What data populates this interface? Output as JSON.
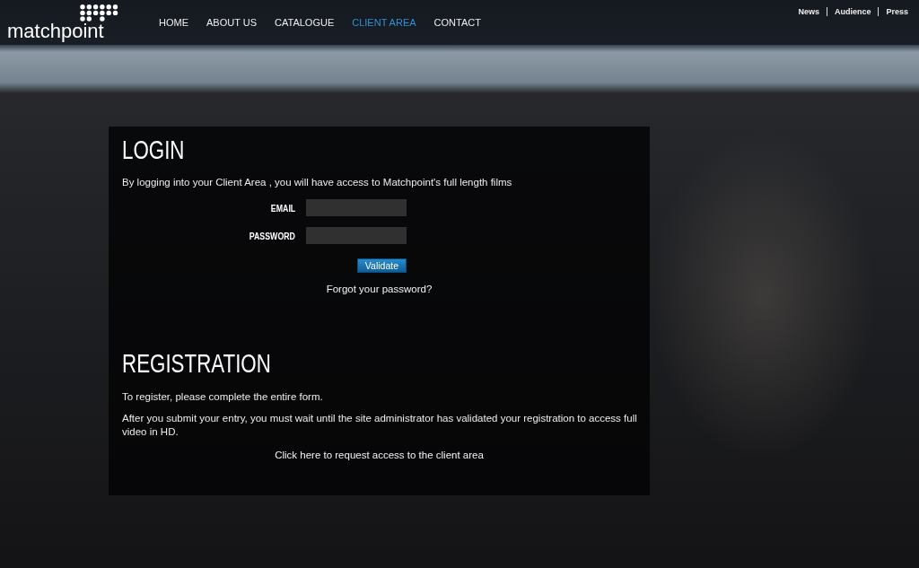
{
  "logo": {
    "text": "matchpoint"
  },
  "nav": [
    {
      "label": "HOME",
      "selected": false
    },
    {
      "label": "ABOUT US",
      "selected": false
    },
    {
      "label": "CATALOGUE",
      "selected": false
    },
    {
      "label": "CLIENT AREA",
      "selected": true
    },
    {
      "label": "CONTACT",
      "selected": false
    }
  ],
  "top_links": [
    "News",
    "Audience",
    "Press"
  ],
  "login": {
    "title": "LOGIN",
    "intro": "By logging into your Client Area , you will have access to Matchpoint's full length films",
    "fields": [
      {
        "label": "EMAIL"
      },
      {
        "label": "PASSWORD"
      }
    ],
    "submit": "Validate",
    "forgot_link": "Forgot your password?"
  },
  "registration": {
    "title": "REGISTRATION",
    "paragraphs": [
      "To register, please complete the entire form.",
      "After you submit your entry, you must wait until the site administrator has validated your registration to access full video in HD."
    ],
    "request_link": "Click here to request access to the client area"
  }
}
